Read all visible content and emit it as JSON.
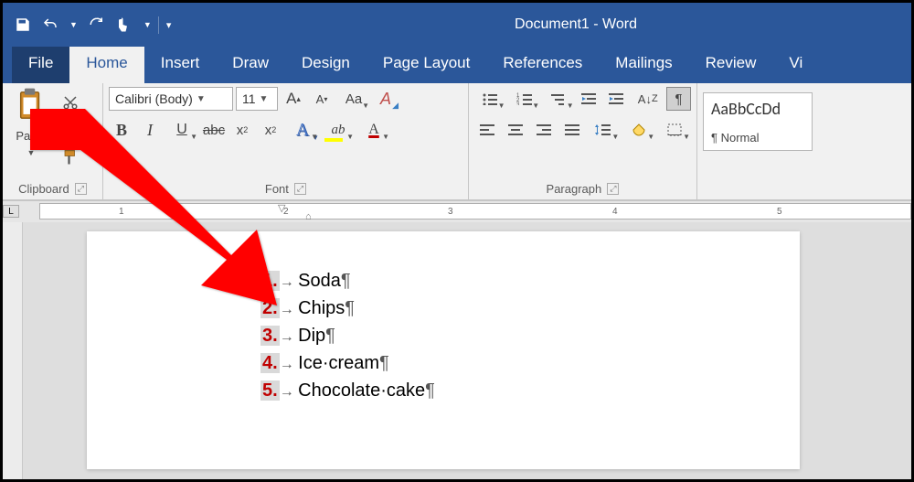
{
  "window": {
    "title": "Document1 - Word"
  },
  "tabs": {
    "file": "File",
    "home": "Home",
    "insert": "Insert",
    "draw": "Draw",
    "design": "Design",
    "pagelayout": "Page Layout",
    "references": "References",
    "mailings": "Mailings",
    "review": "Review",
    "view": "Vi"
  },
  "ribbon": {
    "clipboard": {
      "title": "Clipboard",
      "paste": "Paste"
    },
    "font": {
      "title": "Font",
      "name": "Calibri (Body)",
      "size": "11",
      "bold": "B",
      "italic": "I",
      "underline": "U",
      "strike": "abc",
      "sub": "x",
      "sup": "x",
      "grow": "A",
      "shrink": "A",
      "case": "Aa",
      "clear": "A"
    },
    "paragraph": {
      "title": "Paragraph"
    },
    "styles": {
      "sample": "AaBbCcDd",
      "name": "¶ Normal"
    }
  },
  "ruler": {
    "marks": [
      "1",
      "2",
      "3",
      "4",
      "5"
    ]
  },
  "document": {
    "items": [
      {
        "num": "1.",
        "text": "Soda"
      },
      {
        "num": "2.",
        "text": "Chips"
      },
      {
        "num": "3.",
        "text": "Dip"
      },
      {
        "num": "4.",
        "text": "Ice·cream"
      },
      {
        "num": "5.",
        "text": "Chocolate·cake"
      }
    ]
  }
}
